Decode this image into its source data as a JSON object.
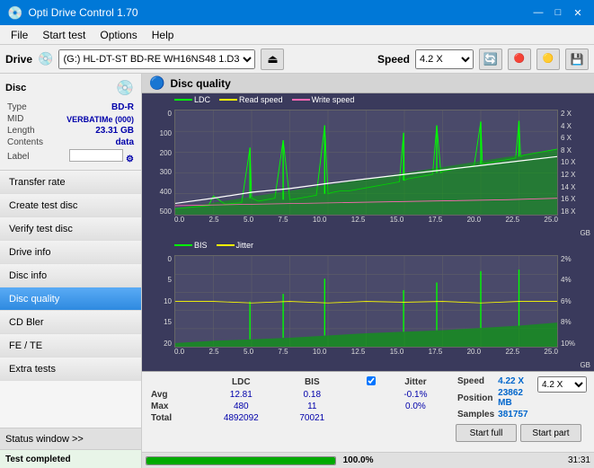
{
  "titlebar": {
    "title": "Opti Drive Control 1.70",
    "icon": "💿",
    "minimize_btn": "—",
    "maximize_btn": "□",
    "close_btn": "✕"
  },
  "menubar": {
    "items": [
      "File",
      "Start test",
      "Options",
      "Help"
    ]
  },
  "drivebar": {
    "label": "Drive",
    "drive_value": "(G:)  HL-DT-ST BD-RE  WH16NS48 1.D3",
    "eject_icon": "⏏",
    "speed_label": "Speed",
    "speed_value": "4.2 X",
    "icon1": "🔄",
    "icon2": "🔴",
    "icon3": "💾",
    "icon4": "🟡"
  },
  "disc_panel": {
    "title": "Disc",
    "disc_icon": "💿",
    "type_label": "Type",
    "type_value": "BD-R",
    "mid_label": "MID",
    "mid_value": "VERBATIMe (000)",
    "length_label": "Length",
    "length_value": "23.31 GB",
    "contents_label": "Contents",
    "contents_value": "data",
    "label_label": "Label",
    "label_value": ""
  },
  "sidebar": {
    "items": [
      {
        "id": "transfer-rate",
        "label": "Transfer rate",
        "active": false
      },
      {
        "id": "create-test-disc",
        "label": "Create test disc",
        "active": false
      },
      {
        "id": "verify-test-disc",
        "label": "Verify test disc",
        "active": false
      },
      {
        "id": "drive-info",
        "label": "Drive info",
        "active": false
      },
      {
        "id": "disc-info",
        "label": "Disc info",
        "active": false
      },
      {
        "id": "disc-quality",
        "label": "Disc quality",
        "active": true
      },
      {
        "id": "cd-bler",
        "label": "CD Bler",
        "active": false
      },
      {
        "id": "fe-te",
        "label": "FE / TE",
        "active": false
      },
      {
        "id": "extra-tests",
        "label": "Extra tests",
        "active": false
      }
    ],
    "status_window_label": "Status window >>",
    "test_completed_label": "Test completed"
  },
  "content_header": {
    "icon": "🔵",
    "title": "Disc quality"
  },
  "chart1": {
    "title": "",
    "legend": [
      {
        "label": "LDC",
        "color": "#00ff00"
      },
      {
        "label": "Read speed",
        "color": "#ffff00"
      },
      {
        "label": "Write speed",
        "color": "#ff69b4"
      }
    ],
    "y_labels": [
      "0",
      "100",
      "200",
      "300",
      "400",
      "500"
    ],
    "y_labels_right": [
      "2 X",
      "4 X",
      "6 X",
      "8 X",
      "10 X",
      "12 X",
      "14 X",
      "16 X",
      "18 X"
    ],
    "x_labels": [
      "0.0",
      "2.5",
      "5.0",
      "7.5",
      "10.0",
      "12.5",
      "15.0",
      "17.5",
      "20.0",
      "22.5",
      "25.0"
    ],
    "x_unit": "GB"
  },
  "chart2": {
    "legend": [
      {
        "label": "BIS",
        "color": "#00ff00"
      },
      {
        "label": "Jitter",
        "color": "#ffff00"
      }
    ],
    "y_labels": [
      "0",
      "5",
      "10",
      "15",
      "20"
    ],
    "y_labels_right": [
      "2%",
      "4%",
      "6%",
      "8%",
      "10%"
    ],
    "x_labels": [
      "0.0",
      "2.5",
      "5.0",
      "7.5",
      "10.0",
      "12.5",
      "15.0",
      "17.5",
      "20.0",
      "22.5",
      "25.0"
    ],
    "x_unit": "GB"
  },
  "stats": {
    "columns": [
      "LDC",
      "BIS",
      "",
      "Jitter",
      "Speed",
      "4.22 X",
      "",
      "4.2 X"
    ],
    "rows": [
      {
        "label": "Avg",
        "ldc": "12.81",
        "bis": "0.18",
        "jitter_label": "",
        "jitter": "-0.1%",
        "position_label": "Position",
        "position": "23862 MB"
      },
      {
        "label": "Max",
        "ldc": "480",
        "bis": "11",
        "jitter": "0.0%",
        "samples_label": "Samples",
        "samples": "381757"
      },
      {
        "label": "Total",
        "ldc": "4892092",
        "bis": "70021",
        "jitter": ""
      }
    ],
    "jitter_checked": true,
    "start_full_label": "Start full",
    "start_part_label": "Start part"
  },
  "progress": {
    "percent": 100,
    "percent_label": "100.0%",
    "time": "31:31"
  },
  "status": {
    "status_window_label": "Status window >>",
    "test_completed": "Test completed"
  }
}
